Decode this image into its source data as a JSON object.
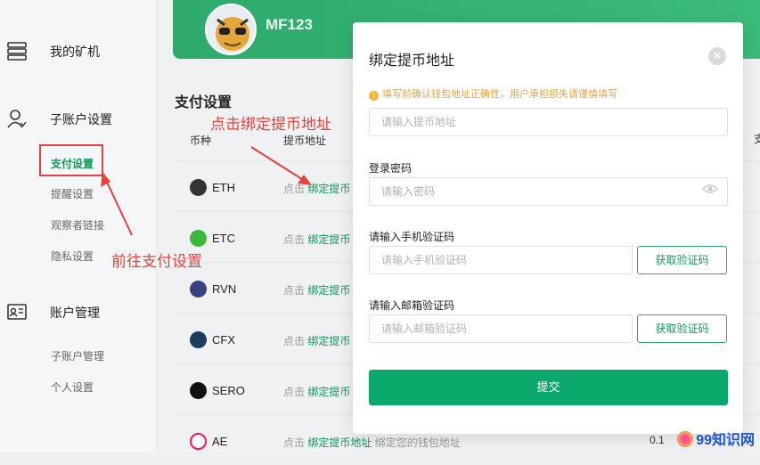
{
  "sidebar": {
    "groups": [
      {
        "label": "我的矿机",
        "icon": "server-icon"
      },
      {
        "label": "子账户设置",
        "icon": "user-icon"
      },
      {
        "label": "账户管理",
        "icon": "id-card-icon"
      }
    ],
    "sub_items_settings": [
      "支付设置",
      "提醒设置",
      "观察者链接",
      "隐私设置"
    ],
    "sub_items_account": [
      "子账户管理",
      "个人设置"
    ]
  },
  "header": {
    "username": "MF123"
  },
  "main": {
    "section_title": "支付设置",
    "columns": [
      "币种",
      "提币地址"
    ],
    "right_col": "支",
    "rows": [
      {
        "coin": "ETH",
        "icon": "eth-icon",
        "color": "#333333",
        "prefix": "点击",
        "link": "绑定提币",
        "suffix": ""
      },
      {
        "coin": "ETC",
        "icon": "etc-icon",
        "color": "#3ab83a",
        "prefix": "点击",
        "link": "绑定提币",
        "suffix": ""
      },
      {
        "coin": "RVN",
        "icon": "rvn-icon",
        "color": "#384182",
        "prefix": "点击",
        "link": "绑定提币",
        "suffix": ""
      },
      {
        "coin": "CFX",
        "icon": "cfx-icon",
        "color": "#1e3a5c",
        "prefix": "点击",
        "link": "绑定提币",
        "suffix": ""
      },
      {
        "coin": "SERO",
        "icon": "sero-icon",
        "color": "#111111",
        "prefix": "点击",
        "link": "绑定提币",
        "suffix": ""
      },
      {
        "coin": "AE",
        "icon": "ae-icon",
        "color": "#ff0d6a",
        "prefix": "点击",
        "link": "绑定提币地址",
        "suffix": "绑定您的钱包地址"
      }
    ],
    "bottom_value": "0.1"
  },
  "annotations": {
    "top": "点击绑定提币地址",
    "left": "前往支付设置"
  },
  "modal": {
    "title": "绑定提币地址",
    "warning": "填写前确认钱包地址正确性，用户承担损失请谨慎填写",
    "address_placeholder": "请输入提币地址",
    "password_label": "登录密码",
    "password_placeholder": "请输入密码",
    "phone_label": "请输入手机验证码",
    "phone_placeholder": "请输入手机验证码",
    "email_label": "请输入邮箱验证码",
    "email_placeholder": "请输入邮箱验证码",
    "get_code_label": "获取验证码",
    "submit_label": "提交"
  },
  "watermark": "99知识网",
  "colors": {
    "accent": "#0aa86a",
    "annotation": "#e8413b",
    "warning": "#e9a23b"
  }
}
